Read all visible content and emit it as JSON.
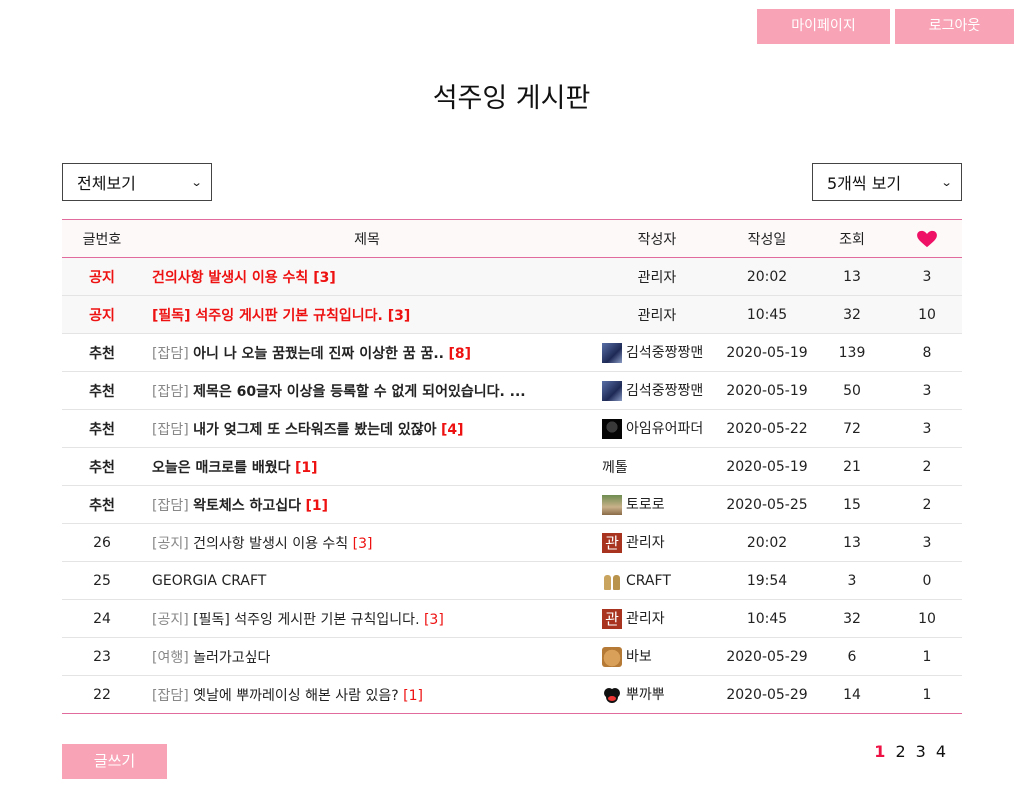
{
  "header": {
    "mypage_label": "마이페이지",
    "logout_label": "로그아웃",
    "title": "석주잉 게시판"
  },
  "filters": {
    "category_selected": "전체보기",
    "page_size_selected": "5개씩 보기"
  },
  "table": {
    "columns": [
      "글번호",
      "제목",
      "작성자",
      "작성일",
      "조회",
      "heart-icon"
    ],
    "rows": [
      {
        "type": "notice",
        "num": "공지",
        "category": "",
        "title": "건의사항 발생시 이용 수칙",
        "comments": "[3]",
        "avatar": "",
        "author": "관리자",
        "date": "20:02",
        "views": "13",
        "likes": "3"
      },
      {
        "type": "notice",
        "num": "공지",
        "category": "",
        "title": "[필독] 석주잉 게시판 기본 규칙입니다.",
        "comments": "[3]",
        "avatar": "",
        "author": "관리자",
        "date": "10:45",
        "views": "32",
        "likes": "10"
      },
      {
        "type": "recommend",
        "num": "추천",
        "category": "[잡담]",
        "title": "아니 나 오늘 꿈꿨는데 진짜 이상한 꿈 꿈..",
        "comments": "[8]",
        "avatar": "photo",
        "author": "김석중짱짱맨",
        "date": "2020-05-19",
        "views": "139",
        "likes": "8"
      },
      {
        "type": "recommend",
        "num": "추천",
        "category": "[잡담]",
        "title": "제목은 60글자 이상을 등록할 수 없게 되어있습니다. ...",
        "comments": "",
        "avatar": "photo",
        "author": "김석중짱짱맨",
        "date": "2020-05-19",
        "views": "50",
        "likes": "3"
      },
      {
        "type": "recommend",
        "num": "추천",
        "category": "[잡담]",
        "title": "내가 엊그제 또 스타워즈를 봤는데 있잖아",
        "comments": "[4]",
        "avatar": "vader",
        "author": "아임유어파더",
        "date": "2020-05-22",
        "views": "72",
        "likes": "3"
      },
      {
        "type": "recommend",
        "num": "추천",
        "category": "",
        "title": "오늘은 매크로를 배웠다",
        "comments": "[1]",
        "avatar": "",
        "author": "께톨",
        "date": "2020-05-19",
        "views": "21",
        "likes": "2"
      },
      {
        "type": "recommend",
        "num": "추천",
        "category": "[잡담]",
        "title": "왁토체스 하고십다",
        "comments": "[1]",
        "avatar": "face",
        "author": "토로로",
        "date": "2020-05-25",
        "views": "15",
        "likes": "2"
      },
      {
        "type": "normal",
        "num": "26",
        "category": "[공지]",
        "title": "건의사항 발생시 이용 수칙",
        "comments": "[3]",
        "avatar": "kanji",
        "author": "관리자",
        "date": "20:02",
        "views": "13",
        "likes": "3"
      },
      {
        "type": "normal",
        "num": "25",
        "category": "",
        "title": "GEORGIA CRAFT",
        "comments": "",
        "avatar": "bottles",
        "author": "CRAFT",
        "date": "19:54",
        "views": "3",
        "likes": "0"
      },
      {
        "type": "normal",
        "num": "24",
        "category": "[공지]",
        "title": "[필독] 석주잉 게시판 기본 규칙입니다.",
        "comments": "[3]",
        "avatar": "kanji",
        "author": "관리자",
        "date": "10:45",
        "views": "32",
        "likes": "10"
      },
      {
        "type": "normal",
        "num": "23",
        "category": "[여행]",
        "title": "놀러가고싶다",
        "comments": "",
        "avatar": "dog",
        "author": "바보",
        "date": "2020-05-29",
        "views": "6",
        "likes": "1"
      },
      {
        "type": "normal",
        "num": "22",
        "category": "[잡담]",
        "title": "옛날에 뿌까레이싱 해본 사람 있음?",
        "comments": "[1]",
        "avatar": "mickey",
        "author": "뿌까뿌",
        "date": "2020-05-29",
        "views": "14",
        "likes": "1"
      }
    ]
  },
  "avatar_text": {
    "kanji": "관"
  },
  "footer": {
    "write_label": "글쓰기",
    "pages": [
      "1",
      "2",
      "3",
      "4"
    ],
    "current_page": "1"
  },
  "colors": {
    "accent_pink": "#f9a3b6",
    "header_border": "#e06b9c",
    "notice_red": "#ee1111",
    "heart": "#ee1166"
  }
}
